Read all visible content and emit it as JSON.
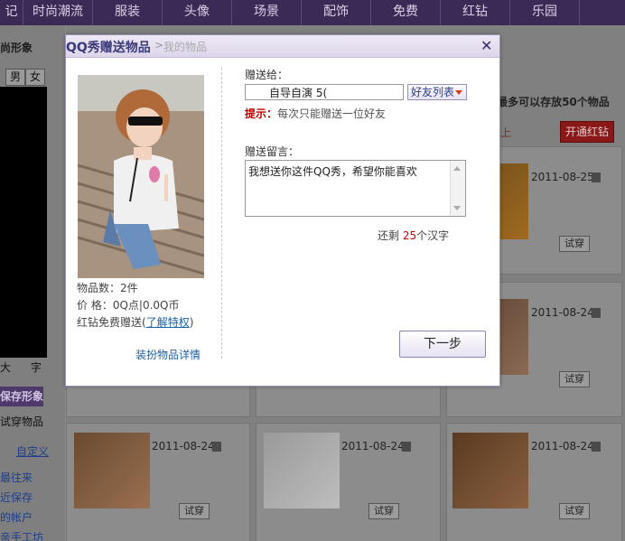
{
  "nav": {
    "items": [
      "记",
      "时尚潮流",
      "服装",
      "头像",
      "场景",
      "配饰",
      "免费",
      "红钻",
      "乐园"
    ]
  },
  "left": {
    "title": "尚形象",
    "gender_male": "男",
    "gender_female": "女",
    "tools_a": "大",
    "tools_b": "字",
    "save": "保存形象",
    "try_items": "试穿物品",
    "custom": "自定义",
    "links": [
      "最往来",
      "近保存",
      "的帐户",
      "亲手工坊"
    ]
  },
  "right": {
    "header": "” 最多可以存放50个物品",
    "link": "上",
    "red_button": "开通红钻"
  },
  "cards": {
    "dates": [
      "2011-08-25",
      "2011-08-24",
      "2011-08-24",
      "2011-08-24",
      "2011-08-24"
    ],
    "try_label": "试穿"
  },
  "dialog": {
    "title": "QQ秀赠送物品",
    "crumb_sep": ">",
    "crumb": "我的物品",
    "close": "✕",
    "to_label": "赠送给：",
    "to_value": "自导自演    5(",
    "friends_button": "好友列表",
    "hint_label": "提示：",
    "hint_text": "每次只能赠送一位好友",
    "msg_label": "赠送留言：",
    "msg_text": "我想送你这件QQ秀，希望你能喜欢",
    "remain_prefix": "还剩",
    "remain_num": "25",
    "remain_suffix": "个汉字",
    "item_count": "物品数：2件",
    "price": "价  格：0Q点|0.0Q币",
    "redzuan": "红钻免费赠送(",
    "privilege_link": "了解特权",
    "redzuan_close": ")",
    "detail_link": "装扮物品详情",
    "next": "下一步"
  },
  "colors": {
    "nav_bg": "#3b2a55",
    "dialog_title": "#3a3a7a",
    "hint_red": "#c00000",
    "link_blue": "#1b5ea3"
  }
}
